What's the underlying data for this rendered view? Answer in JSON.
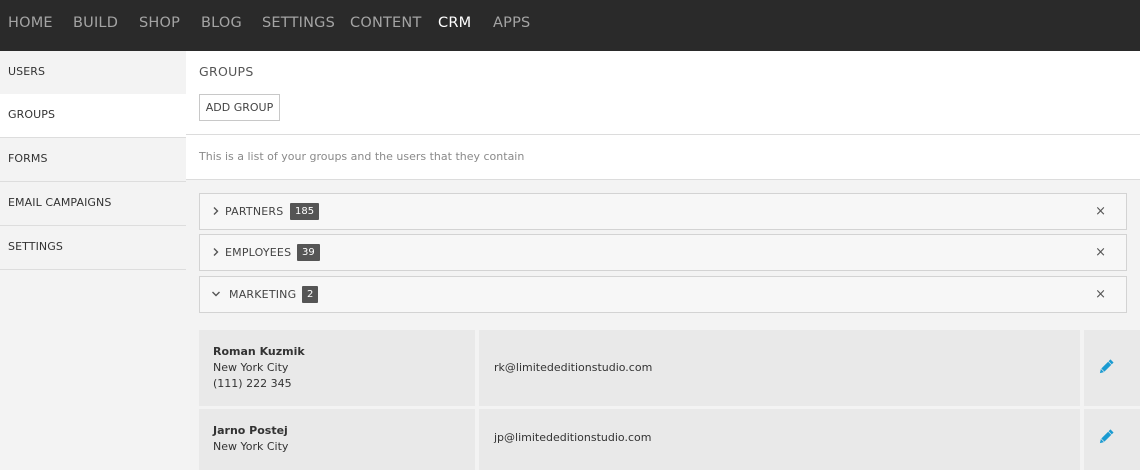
{
  "topnav": {
    "items": [
      {
        "label": "HOME",
        "active": false
      },
      {
        "label": "BUILD",
        "active": false
      },
      {
        "label": "SHOP",
        "active": false
      },
      {
        "label": "BLOG",
        "active": false
      },
      {
        "label": "SETTINGS",
        "active": false
      },
      {
        "label": "CONTENT",
        "active": false
      },
      {
        "label": "CRM",
        "active": true
      },
      {
        "label": "APPS",
        "active": false
      }
    ]
  },
  "sidebar": {
    "items": [
      {
        "label": "USERS",
        "active": false
      },
      {
        "label": "GROUPS",
        "active": true
      },
      {
        "label": "FORMS",
        "active": false
      },
      {
        "label": "EMAIL CAMPAIGNS",
        "active": false
      },
      {
        "label": "SETTINGS",
        "active": false
      }
    ]
  },
  "main": {
    "title": "GROUPS",
    "add_button": "ADD GROUP",
    "intro": "This is a list of your groups and the users that they contain",
    "close_glyph": "×",
    "groups": [
      {
        "name": "PARTNERS",
        "count": "185",
        "expanded": false
      },
      {
        "name": "EMPLOYEES",
        "count": "39",
        "expanded": false
      },
      {
        "name": "MARKETING",
        "count": "2",
        "expanded": true
      }
    ],
    "users": [
      {
        "name": "Roman Kuzmik",
        "city": "New York City",
        "phone": "(111) 222 345",
        "email": "rk@limitededitionstudio.com"
      },
      {
        "name": "Jarno Postej",
        "city": "New York City",
        "email": "jp@limitededitionstudio.com"
      }
    ]
  },
  "colors": {
    "topbar": "#2a2a2a",
    "accent_edit": "#1a9bd1",
    "badge": "#555555"
  },
  "icons": {
    "collapsed": "chevron-right-icon",
    "expanded": "chevron-down-icon",
    "remove": "close-icon",
    "edit": "pencil-icon"
  }
}
